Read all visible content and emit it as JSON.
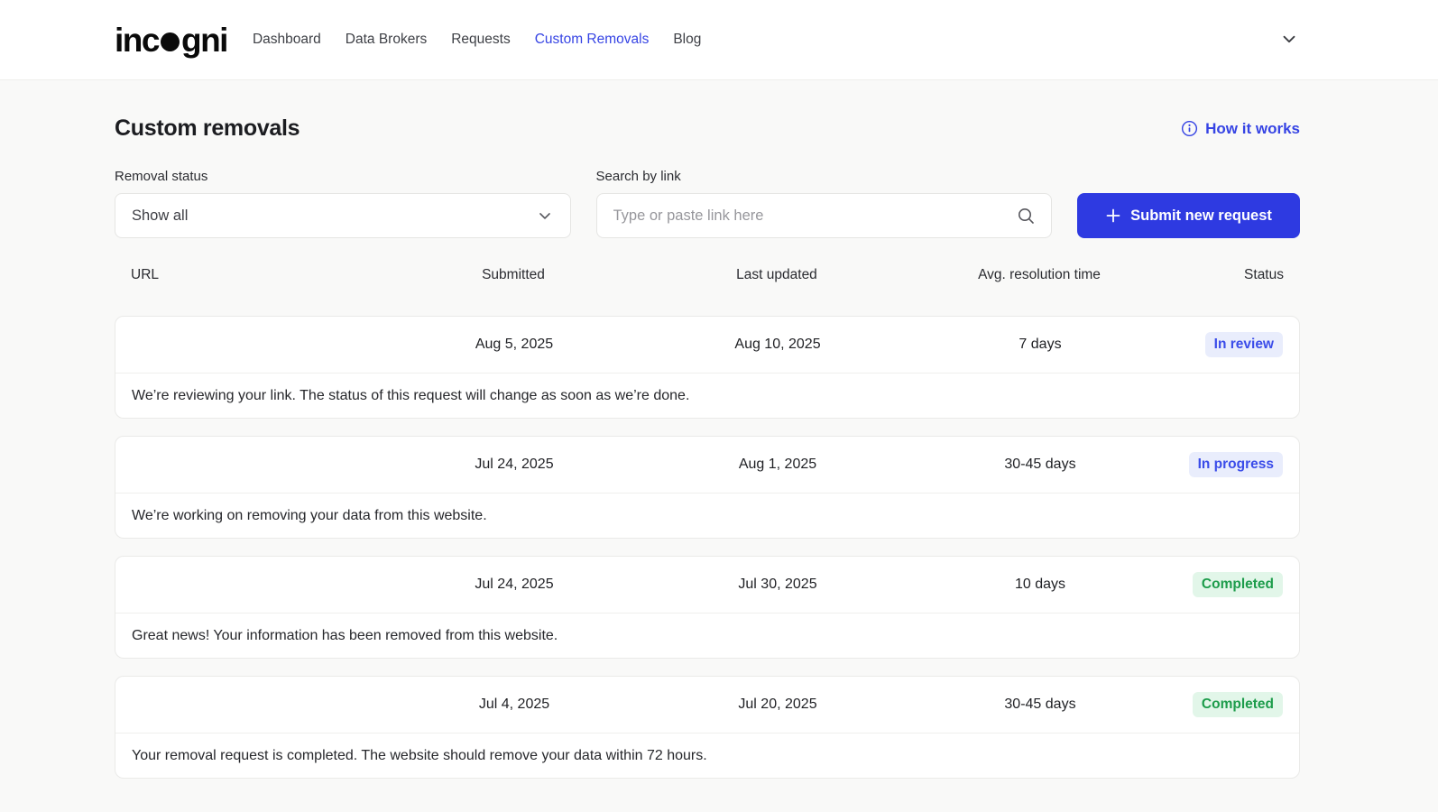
{
  "header": {
    "logo": {
      "pre": "inc",
      "post": "gni",
      "brand": "incogni"
    },
    "nav_items": [
      {
        "label": "Dashboard",
        "active": false
      },
      {
        "label": "Data Brokers",
        "active": false
      },
      {
        "label": "Requests",
        "active": false
      },
      {
        "label": "Custom Removals",
        "active": true
      },
      {
        "label": "Blog",
        "active": false
      }
    ]
  },
  "page": {
    "title": "Custom removals",
    "how_it_works_label": "How it works"
  },
  "filters": {
    "status_label": "Removal status",
    "status_value": "Show all",
    "search_label": "Search by link",
    "search_placeholder": "Type or paste link here",
    "submit_button_label": "Submit new request"
  },
  "table": {
    "columns": [
      "URL",
      "Submitted",
      "Last updated",
      "Avg. resolution time",
      "Status"
    ],
    "rows": [
      {
        "submitted": "Aug 5, 2025",
        "last_updated": "Aug 10, 2025",
        "avg_resolution": "7 days",
        "status": "In review",
        "status_type": "review",
        "message": "We’re reviewing your link. The status of this request will change as soon as we’re done."
      },
      {
        "submitted": "Jul 24, 2025",
        "last_updated": "Aug 1, 2025",
        "avg_resolution": "30-45 days",
        "status": "In progress",
        "status_type": "progress",
        "message": "We’re working on removing your data from this website."
      },
      {
        "submitted": "Jul 24, 2025",
        "last_updated": "Jul 30, 2025",
        "avg_resolution": "10 days",
        "status": "Completed",
        "status_type": "completed",
        "message": "Great news! Your information has been removed from this website."
      },
      {
        "submitted": "Jul 4, 2025",
        "last_updated": "Jul 20, 2025",
        "avg_resolution": "30-45 days",
        "status": "Completed",
        "status_type": "completed",
        "message": "Your removal request is completed. The website should remove your data within 72 hours."
      }
    ]
  },
  "colors": {
    "accent_blue": "#3644e4",
    "button_blue": "#2e3ae1",
    "badge_blue_bg": "#e9edfc",
    "badge_blue_text": "#3a4ce9",
    "badge_green_bg": "#e2f6e9",
    "badge_green_text": "#1d9c4b",
    "page_background": "#f9f9f8"
  }
}
